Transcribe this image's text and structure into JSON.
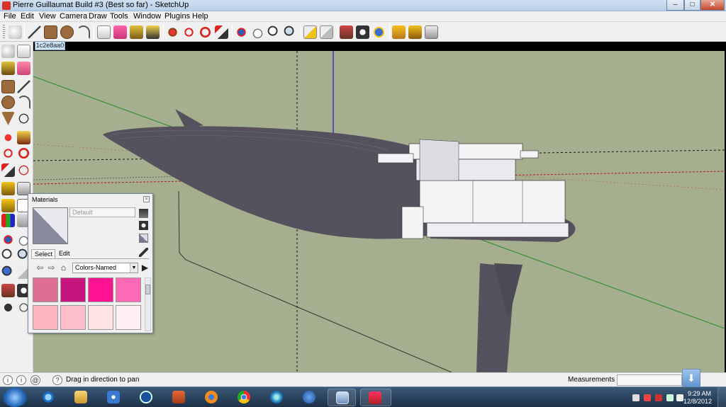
{
  "window": {
    "title": "Pierre Guillaumat Build #3 (Best so far) - SketchUp",
    "controls": {
      "minimize": "–",
      "maximize": "□",
      "close": "✕"
    }
  },
  "menu": [
    "File",
    "Edit",
    "View",
    "Camera",
    "Draw",
    "Tools",
    "Window",
    "Plugins",
    "Help"
  ],
  "toolbar": {
    "icons": [
      "select-icon",
      "line-icon",
      "rectangle-icon",
      "circle-icon",
      "arc-icon",
      "make-component-icon",
      "eraser-icon",
      "paint-bucket-icon",
      "push-pull-icon",
      "move-icon",
      "rotate-icon",
      "follow-me-icon",
      "orbit-icon",
      "pan-icon",
      "zoom-icon",
      "zoom-extents-icon",
      "previous-view-icon",
      "next-view-icon",
      "position-camera-icon",
      "walk-icon",
      "look-around-icon",
      "get-models-icon",
      "share-model-icon",
      "share-component-icon"
    ]
  },
  "palette": {
    "icons": [
      "select-icon",
      "make-component-icon",
      "paint-bucket-icon",
      "eraser-icon",
      "rectangle-icon",
      "line-icon",
      "circle-icon",
      "arc-icon",
      "polygon-icon",
      "freehand-icon",
      "move-icon",
      "push-pull-icon",
      "rotate-icon",
      "follow-me-icon",
      "scale-icon",
      "offset-icon",
      "tape-measure-icon",
      "dimension-icon",
      "protractor-icon",
      "text-icon",
      "axes-icon",
      "3d-text-icon",
      "orbit-icon",
      "pan-icon",
      "zoom-icon",
      "zoom-window-icon",
      "zoom-extents-icon",
      "previous-icon",
      "position-camera-icon",
      "look-around-icon",
      "walk-icon",
      "section-plane-icon"
    ]
  },
  "scene_tab": "1c2e8aa0",
  "materials": {
    "title": "Materials",
    "material_name": "Default",
    "tabs": [
      "Select",
      "Edit"
    ],
    "library": "Colors-Named",
    "swatches": [
      "#df6e95",
      "#c7157e",
      "#fe1493",
      "#fd69b4",
      "#ffb6c1",
      "#ffc0cb",
      "#ffe4e1",
      "#fff0f5"
    ]
  },
  "status": {
    "hint": "Drag in direction to pan",
    "measurements_label": "Measurements",
    "measurements_value": ""
  },
  "taskbar": {
    "apps": [
      "internet-explorer-icon",
      "file-explorer-icon",
      "media-player-icon",
      "hp-icon",
      "pinned-app-icon",
      "firefox-icon",
      "chrome-icon",
      "zune-icon",
      "help-icon",
      "window-app-icon",
      "sketchup-icon"
    ],
    "time": "9:29 AM",
    "date": "12/8/2012"
  },
  "colors": {
    "viewport_bg": "#a5ae8e",
    "hull": "#55525d",
    "superstructure": "#f4f4f6",
    "axis_red": "#b02020",
    "axis_green": "#2a8a2a",
    "axis_blue": "#1a1acb"
  }
}
